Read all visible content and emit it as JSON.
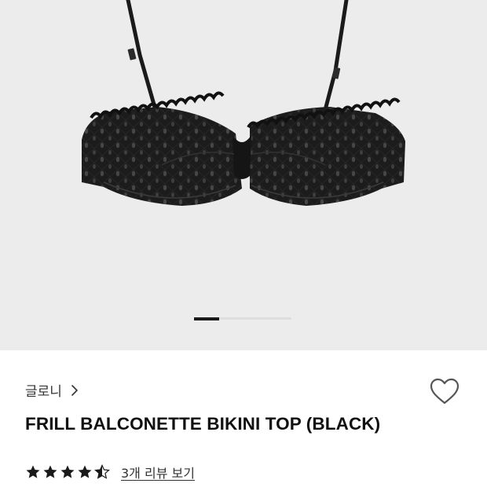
{
  "gallery": {
    "image_alt": "black eyelet frill balconette bikini top",
    "current_slide": 1,
    "total_slides": 4
  },
  "brand": {
    "name": "글로니",
    "chevron_icon": "chevron-right-icon"
  },
  "wishlist": {
    "icon": "heart-outline-icon",
    "active": false
  },
  "product": {
    "title": "FRILL BALCONETTE BIKINI TOP (BLACK)"
  },
  "rating": {
    "stars": 4.5,
    "max_stars": 5,
    "star_icon": "star-icon",
    "review_link": "3개 리뷰 보기"
  },
  "colors": {
    "gallery_bg": "#ececec",
    "fabric": "#1c1c1c",
    "text_primary": "#111111",
    "star": "#1a1a1a",
    "heart_stroke": "#555555"
  }
}
